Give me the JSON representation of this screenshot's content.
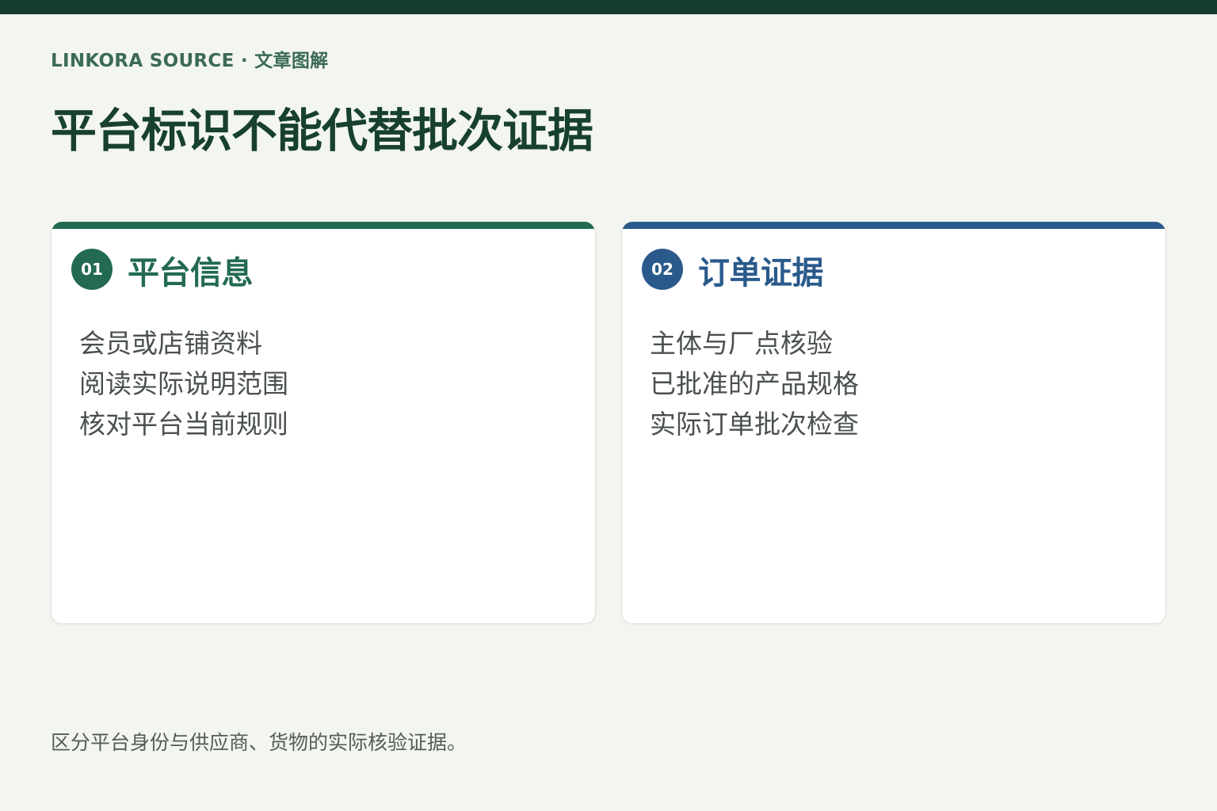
{
  "header": {
    "eyebrow": "LINKORA SOURCE · 文章图解",
    "title": "平台标识不能代替批次证据"
  },
  "cards": [
    {
      "number": "01",
      "heading": "平台信息",
      "accent_color": "#236a51",
      "items": [
        "会员或店铺资料",
        "阅读实际说明范围",
        "核对平台当前规则"
      ]
    },
    {
      "number": "02",
      "heading": "订单证据",
      "accent_color": "#2a5a8c",
      "items": [
        "主体与厂点核验",
        "已批准的产品规格",
        "实际订单批次检查"
      ]
    }
  ],
  "footer": {
    "note": "区分平台身份与供应商、货物的实际核验证据。"
  },
  "colors": {
    "background": "#f3f5f0",
    "top_bar": "#163d31",
    "title": "#17402f"
  }
}
